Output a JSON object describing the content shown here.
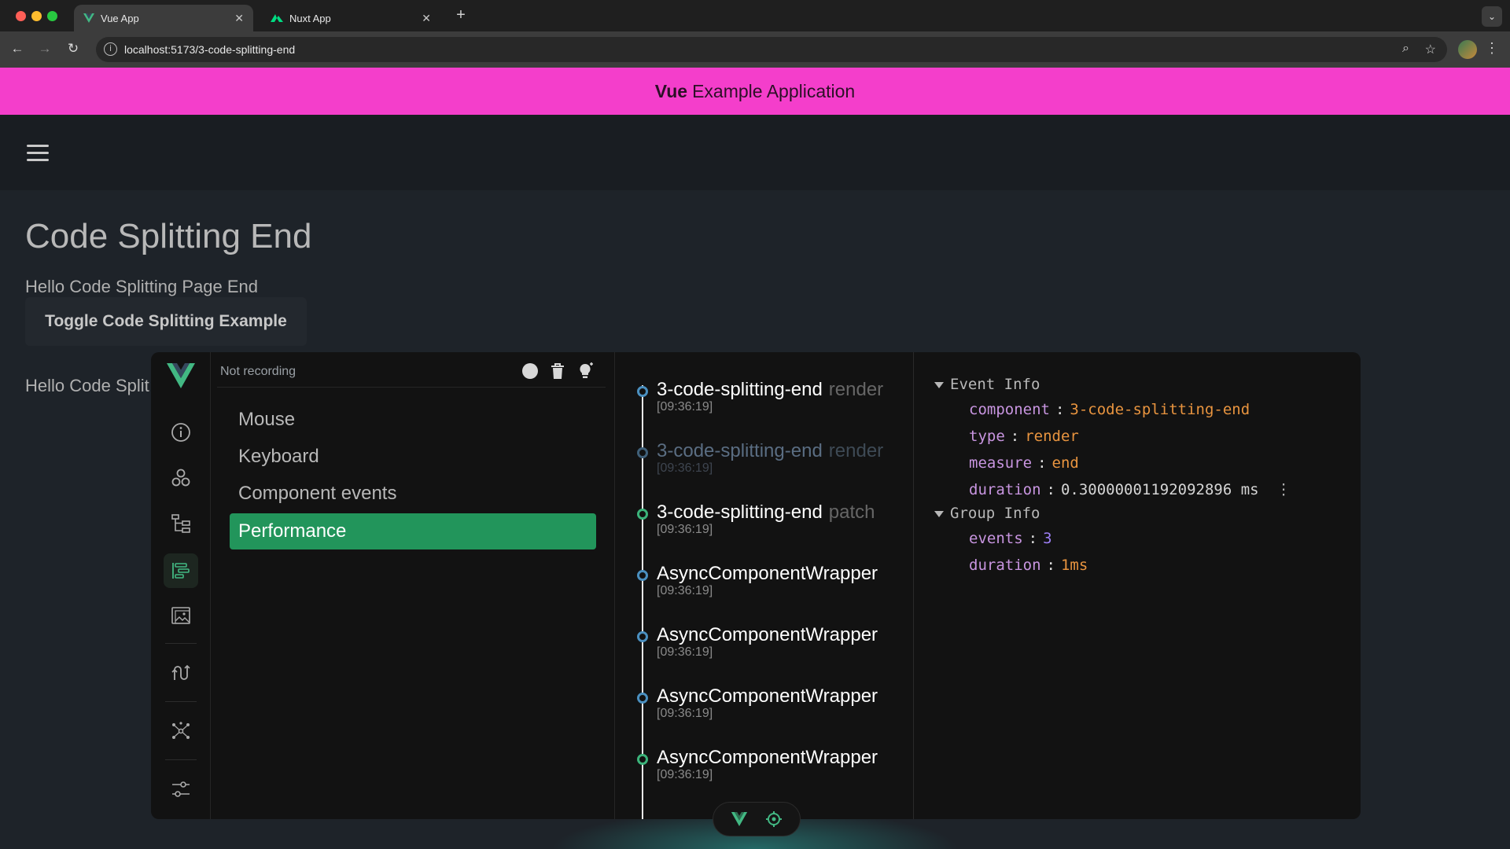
{
  "browser": {
    "tabs": [
      {
        "title": "Vue App",
        "active": true
      },
      {
        "title": "Nuxt App",
        "active": false
      }
    ],
    "url": "localhost:5173/3-code-splitting-end"
  },
  "app": {
    "header_bold": "Vue",
    "header_rest": "Example Application",
    "page_title": "Code Splitting End",
    "page_text": "Hello Code Splitting Page End",
    "toggle_button": "Toggle Code Splitting Example",
    "page_text_2": "Hello Code Split"
  },
  "devtools": {
    "record_status": "Not recording",
    "layers": [
      {
        "label": "Mouse",
        "selected": false
      },
      {
        "label": "Keyboard",
        "selected": false
      },
      {
        "label": "Component events",
        "selected": false
      },
      {
        "label": "Performance",
        "selected": true
      }
    ],
    "events": [
      {
        "name": "3-code-splitting-end",
        "sub": "render",
        "time": "[09:36:19]",
        "dot": "blue",
        "faded": false
      },
      {
        "name": "3-code-splitting-end",
        "sub": "render",
        "time": "[09:36:19]",
        "dot": "blue",
        "faded": true
      },
      {
        "name": "3-code-splitting-end",
        "sub": "patch",
        "time": "[09:36:19]",
        "dot": "green",
        "faded": false
      },
      {
        "name": "AsyncComponentWrapper",
        "sub": "",
        "time": "[09:36:19]",
        "dot": "blue",
        "faded": false
      },
      {
        "name": "AsyncComponentWrapper",
        "sub": "",
        "time": "[09:36:19]",
        "dot": "blue",
        "faded": false
      },
      {
        "name": "AsyncComponentWrapper",
        "sub": "",
        "time": "[09:36:19]",
        "dot": "blue",
        "faded": false
      },
      {
        "name": "AsyncComponentWrapper",
        "sub": "",
        "time": "[09:36:19]",
        "dot": "green",
        "faded": false
      }
    ],
    "event_info": {
      "title": "Event Info",
      "component_key": "component",
      "component_val": "3-code-splitting-end",
      "type_key": "type",
      "type_val": "render",
      "measure_key": "measure",
      "measure_val": "end",
      "duration_key": "duration",
      "duration_val": "0.30000001192092896 ms"
    },
    "group_info": {
      "title": "Group Info",
      "events_key": "events",
      "events_val": "3",
      "duration_key": "duration",
      "duration_val": "1ms"
    }
  },
  "colors": {
    "header_pink": "#f43ecb",
    "selected_green": "#22955b",
    "vue_green": "#42b883"
  }
}
